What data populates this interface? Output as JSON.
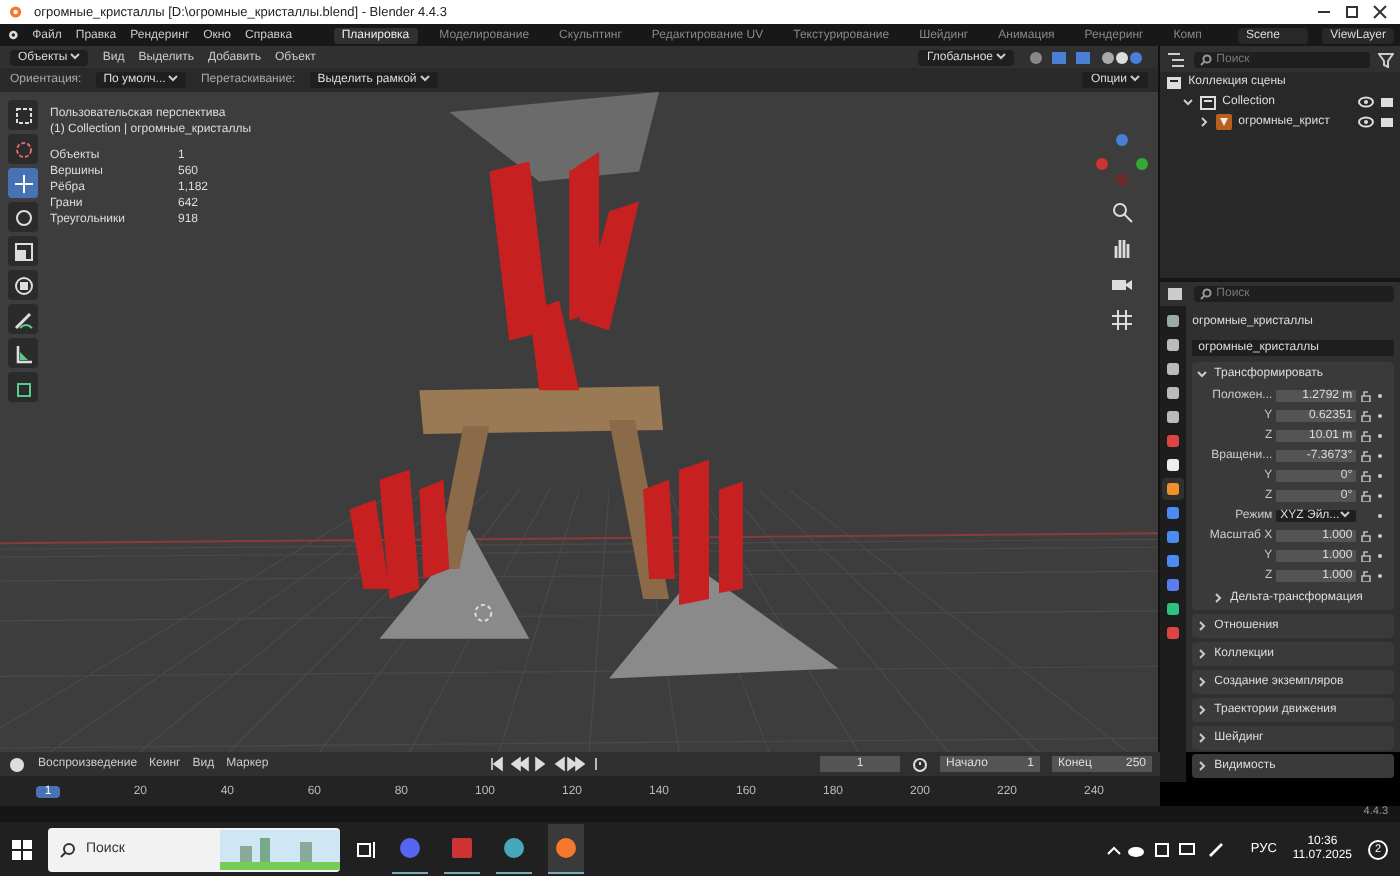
{
  "window": {
    "title": "огромные_кристаллы [D:\\огромные_кристаллы.blend] - Blender 4.4.3"
  },
  "menu": [
    "Файл",
    "Правка",
    "Рендеринг",
    "Окно",
    "Справка"
  ],
  "workspaces": [
    {
      "label": "Планировка",
      "selected": true
    },
    {
      "label": "Моделирование",
      "selected": false
    },
    {
      "label": "Скульптинг",
      "selected": false
    },
    {
      "label": "Редактирование UV",
      "selected": false
    },
    {
      "label": "Текстурирование",
      "selected": false
    },
    {
      "label": "Шейдинг",
      "selected": false
    },
    {
      "label": "Анимация",
      "selected": false
    },
    {
      "label": "Рендеринг",
      "selected": false
    },
    {
      "label": "Комп",
      "selected": false
    }
  ],
  "scene": "Scene",
  "view_layer": "ViewLayer",
  "viewport_header": {
    "mode": "Объекты",
    "menus": [
      "Вид",
      "Выделить",
      "Добавить",
      "Объект"
    ],
    "transform": "Глобальное"
  },
  "tool_settings": {
    "orientation_label": "Ориентация:",
    "orientation": "По умолч...",
    "drag_label": "Перетаскивание:",
    "drag": "Выделить рамкой",
    "options": "Опции"
  },
  "tools": [
    {
      "kind": "select",
      "selected": false
    },
    {
      "kind": "cursor",
      "selected": false
    },
    {
      "kind": "move",
      "selected": true
    },
    {
      "kind": "rotate",
      "selected": false
    },
    {
      "kind": "scale",
      "selected": false
    },
    {
      "kind": "transform",
      "selected": false
    },
    {
      "kind": "annotate",
      "selected": false
    },
    {
      "kind": "measure",
      "selected": false
    },
    {
      "kind": "add-cube",
      "selected": false
    }
  ],
  "overlay": {
    "view": "Пользовательская перспектива",
    "context": "(1) Collection | огромные_кристаллы",
    "stats": [
      {
        "label": "Объекты",
        "value": "1"
      },
      {
        "label": "Вершины",
        "value": "560"
      },
      {
        "label": "Рёбра",
        "value": "1,182"
      },
      {
        "label": "Грани",
        "value": "642"
      },
      {
        "label": "Треугольники",
        "value": "918"
      }
    ]
  },
  "outliner": {
    "search": {
      "placeholder": "Поиск"
    },
    "items": [
      {
        "label": "Коллекция сцены",
        "kind": "scene-collection",
        "children": [
          {
            "label": "Collection",
            "kind": "collection",
            "expanded": true,
            "children": [
              {
                "label": "огромные_крист",
                "kind": "object",
                "expanded": false
              }
            ]
          }
        ]
      }
    ]
  },
  "properties": {
    "search": {
      "placeholder": "Поиск"
    },
    "object_name": "огромные_кристаллы",
    "data_name": "огромные_кристаллы",
    "tabs": [
      {
        "kind": "tool",
        "selected": false
      },
      {
        "kind": "render",
        "selected": false
      },
      {
        "kind": "output",
        "selected": false
      },
      {
        "kind": "view-layer",
        "selected": false
      },
      {
        "kind": "scene",
        "selected": false
      },
      {
        "kind": "world",
        "selected": false
      },
      {
        "kind": "collection",
        "selected": false
      },
      {
        "kind": "object",
        "selected": true
      },
      {
        "kind": "modifiers",
        "selected": false
      },
      {
        "kind": "particles",
        "selected": false
      },
      {
        "kind": "physics",
        "selected": false
      },
      {
        "kind": "constraints",
        "selected": false
      },
      {
        "kind": "data",
        "selected": false
      },
      {
        "kind": "material",
        "selected": false
      }
    ],
    "transform": {
      "title": "Трансформировать",
      "expanded": true,
      "rows": [
        {
          "label": "Положен...",
          "value": "1.2792 m",
          "kind": "number"
        },
        {
          "label": "Y",
          "value": "0.62351",
          "kind": "number"
        },
        {
          "label": "Z",
          "value": "10.01 m",
          "kind": "number"
        },
        {
          "label": "Вращени...",
          "value": "-7.3673°",
          "kind": "number"
        },
        {
          "label": "Y",
          "value": "0°",
          "kind": "number"
        },
        {
          "label": "Z",
          "value": "0°",
          "kind": "number"
        },
        {
          "label": "Режим",
          "value": "XYZ Эйл...",
          "kind": "dropdown"
        },
        {
          "label": "Масштаб X",
          "value": "1.000",
          "kind": "number"
        },
        {
          "label": "Y",
          "value": "1.000",
          "kind": "number"
        },
        {
          "label": "Z",
          "value": "1.000",
          "kind": "number"
        }
      ],
      "subsection": {
        "title": "Дельта-трансформация",
        "expanded": false
      }
    },
    "panels": [
      {
        "title": "Отношения",
        "expanded": false
      },
      {
        "title": "Коллекции",
        "expanded": false
      },
      {
        "title": "Создание экземпляров",
        "expanded": false
      },
      {
        "title": "Траектории движения",
        "expanded": false
      },
      {
        "title": "Шейдинг",
        "expanded": false
      },
      {
        "title": "Видимость",
        "expanded": false
      }
    ]
  },
  "timeline": {
    "menus": [
      "Воспроизведение",
      "Кеинг",
      "Вид",
      "Маркер"
    ],
    "frame": "1",
    "start_label": "Начало",
    "start": "1",
    "end_label": "Конец",
    "end": "250",
    "current": "1",
    "ticks": [
      "20",
      "40",
      "60",
      "80",
      "100",
      "120",
      "140",
      "160",
      "180",
      "200",
      "220",
      "240"
    ]
  },
  "version": "4.4.3",
  "taskbar": {
    "search": {
      "placeholder": "Поиск"
    },
    "apps": [
      {
        "kind": "chat",
        "selected": false
      },
      {
        "kind": "editor",
        "selected": false
      },
      {
        "kind": "steam",
        "selected": false
      },
      {
        "kind": "blender",
        "selected": true
      }
    ],
    "language": "РУС",
    "time": "10:36",
    "date": "11.07.2025",
    "notifications": "2"
  }
}
